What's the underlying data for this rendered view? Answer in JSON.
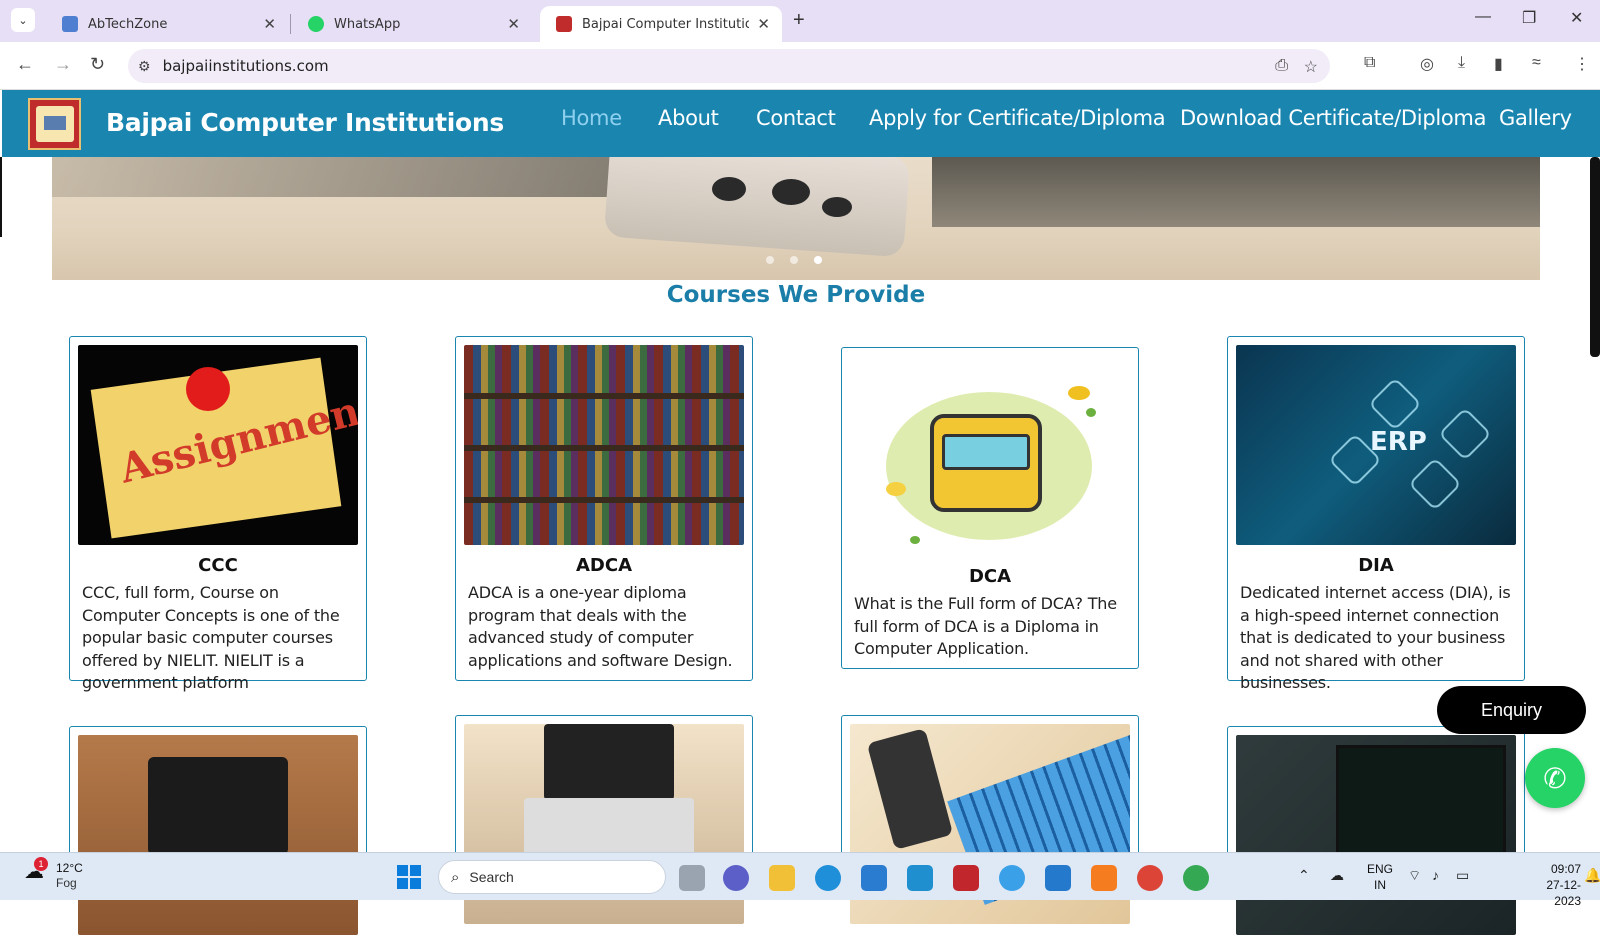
{
  "browser": {
    "tabs": [
      {
        "title": "AbTechZone",
        "active": false
      },
      {
        "title": "WhatsApp",
        "active": false
      },
      {
        "title": "Bajpai Computer Institution",
        "active": true
      }
    ],
    "url": "bajpaiinstitutions.com"
  },
  "site": {
    "brand": "Bajpai Computer Institutions",
    "nav": [
      "Home",
      "About",
      "Contact",
      "Apply for Certificate/Diploma",
      "Download Certificate/Diploma",
      "Gallery"
    ],
    "active_nav": "Home",
    "accent_color": "#1a86b0",
    "section_title": "Courses We Provide",
    "courses": [
      {
        "title": "CCC",
        "text": "CCC, full form, Course on Computer Concepts is one of the popular basic computer courses offered by NIELIT. NIELIT is a government platform"
      },
      {
        "title": "ADCA",
        "text": "ADCA is a one-year diploma program that deals with the advanced study of computer applications and software Design."
      },
      {
        "title": "DCA",
        "text": "What is the Full form of DCA? The full form of DCA is a Diploma in Computer Application."
      },
      {
        "title": "DIA",
        "text": "Dedicated internet access (DIA), is a high-speed internet connection that is dedicated to your business and not shared with other businesses."
      }
    ],
    "dia_image_text": "ERP",
    "ccc_image_text": "Assignment",
    "enquiry_label": "Enquiry"
  },
  "taskbar": {
    "weather_temp": "12°C",
    "weather_cond": "Fog",
    "weather_badge": "1",
    "search_placeholder": "Search",
    "lang_top": "ENG",
    "lang_bottom": "IN",
    "time": "09:07",
    "date": "27-12-2023"
  }
}
